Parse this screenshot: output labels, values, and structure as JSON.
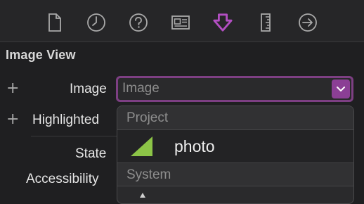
{
  "toolbar": {
    "icons": [
      {
        "name": "file-icon"
      },
      {
        "name": "history-icon"
      },
      {
        "name": "help-icon"
      },
      {
        "name": "identity-icon"
      },
      {
        "name": "attributes-icon",
        "active": true
      },
      {
        "name": "size-ruler-icon"
      },
      {
        "name": "connections-icon"
      }
    ],
    "active_color": "#b34fc3",
    "icon_color": "#a9a9a9"
  },
  "section": {
    "title": "Image View"
  },
  "rows": {
    "image_label": "Image",
    "highlighted_label": "Highlighted",
    "state_label": "State",
    "accessibility_label": "Accessibility"
  },
  "image_select": {
    "placeholder": "Image",
    "accent": "#8b3f95"
  },
  "dropdown": {
    "project_header": "Project",
    "project_items": [
      {
        "label": "photo",
        "icon": "image-thumbnail-icon"
      }
    ],
    "system_header": "System"
  }
}
